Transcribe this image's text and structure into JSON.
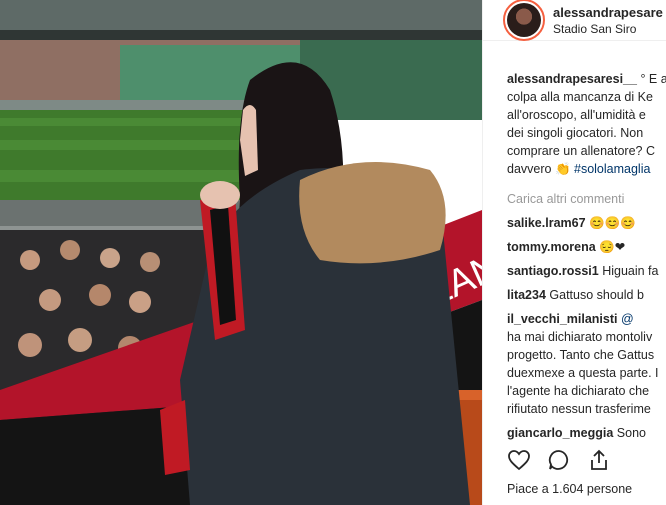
{
  "post": {
    "username": "alessandrapesare",
    "location": "Stadio San Siro"
  },
  "photo": {
    "banner_text": "CMILAN",
    "stadium_sign": "AC MILAN"
  },
  "caption": {
    "author": "alessandrapesaresi__",
    "lines": [
      "° E a",
      "colpa alla mancanza di Ke",
      "all'oroscopo, all'umidità e",
      "dei singoli giocatori. Non",
      "comprare un allenatore? C",
      "davvero"
    ],
    "hashtag": "#sololamaglia"
  },
  "load_more": "Carica altri commenti",
  "comments": [
    {
      "user": "salike.lra",
      "text": "m67",
      "emoji": "😊😊😊"
    },
    {
      "user": "tommy.morena",
      "text": "",
      "emoji": "😔❤"
    },
    {
      "user": "santiago.rossi1",
      "text": "Higuain fa"
    },
    {
      "user": "lita234",
      "text": "Gattuso should b"
    },
    {
      "user": "il_vecchi_milanisti",
      "text": "@"
    }
  ],
  "long_comment_lines": [
    "ha mai dichiarato montoliv",
    "progetto. Tanto che Gattus",
    "duexmexe a questa parte. I",
    "l'agente ha dichiarato che",
    "rifiutato nessun trasferime"
  ],
  "last_comment": {
    "user": "giancarlo_meggia",
    "text": "Sono"
  },
  "likes": "Piace a 1.604 persone",
  "icons": [
    "heart-icon",
    "comment-icon",
    "share-icon"
  ],
  "colors": {
    "banner_red": "#b3142a",
    "seat_orange": "#d8622a",
    "pitch_green": "#3f7a2c"
  }
}
